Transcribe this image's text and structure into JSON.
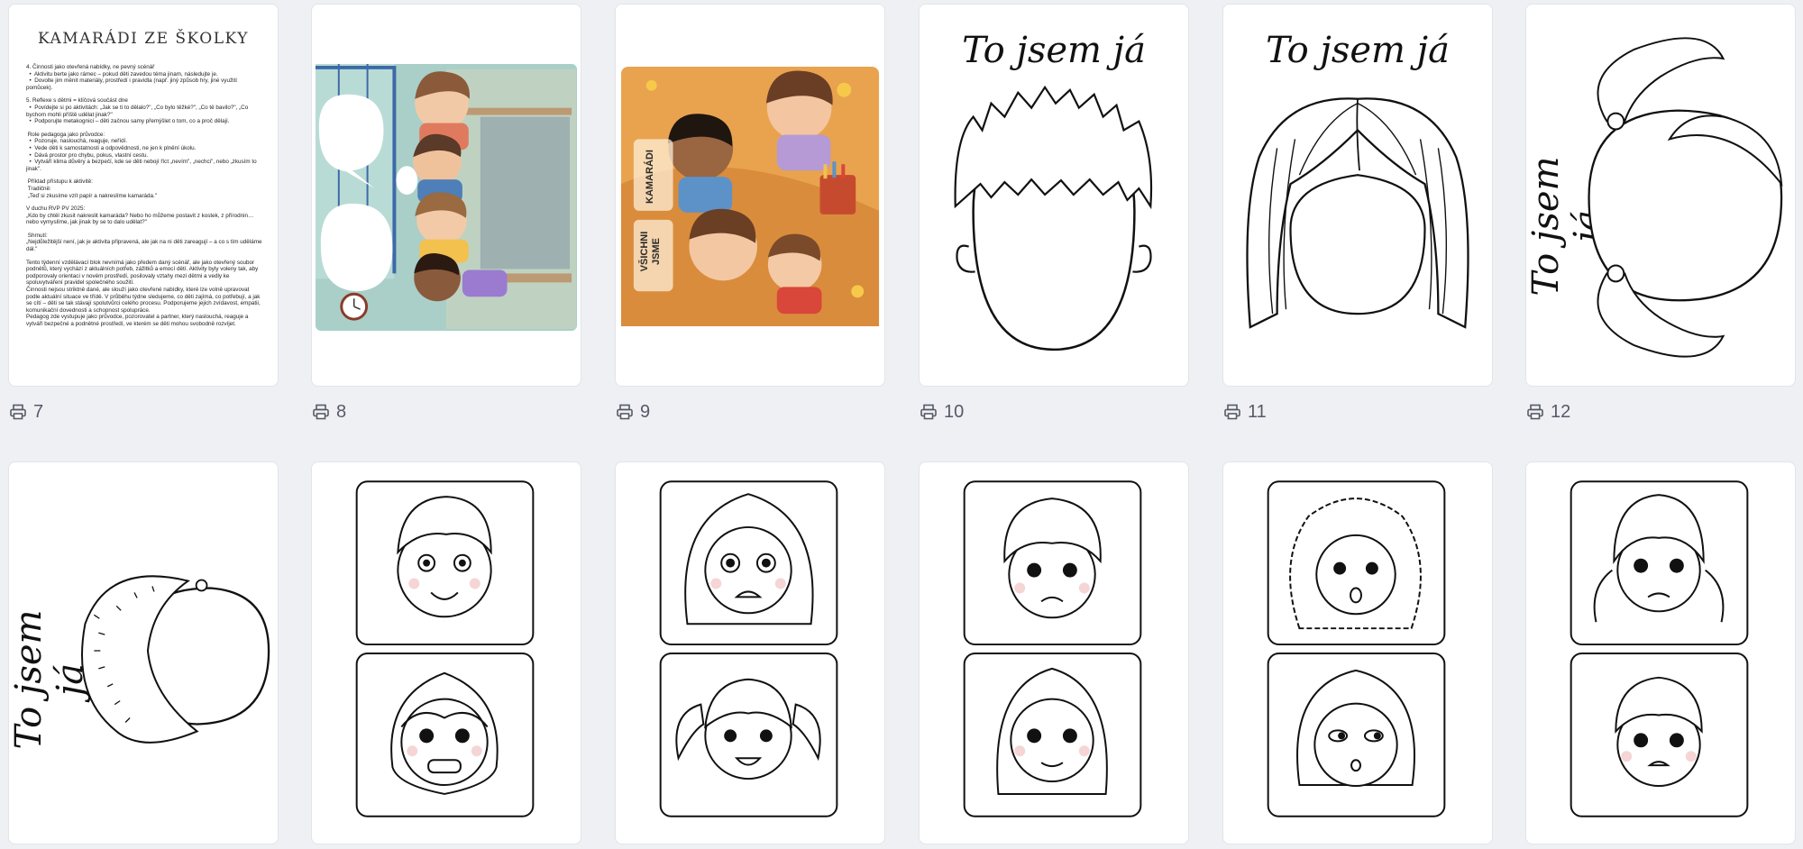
{
  "pages": [
    {
      "number": "7",
      "kind": "document"
    },
    {
      "number": "8",
      "kind": "illustration-classroom"
    },
    {
      "number": "9",
      "kind": "illustration-friends"
    },
    {
      "number": "10",
      "kind": "face-boy"
    },
    {
      "number": "11",
      "kind": "face-girl"
    },
    {
      "number": "12",
      "kind": "face-pigtails"
    }
  ],
  "document": {
    "title": "KAMARÁDI ZE ŠKOLKY",
    "lines": [
      "4. Činnosti jako otevřená nabídky, ne pevný scénář",
      "  •  Aktivitu berte jako rámec – pokud děti zavedou téma jinam, následujte je.",
      "  •  Dovolte jim měnit materiály, prostředí i pravidla (např. jiný způsob hry, jiné využití pomůcek).",
      "",
      "5. Reflexe s dětmi = klíčová součást dne",
      "  •  Povídejte si po aktivitách: „Jak se ti to dělalo?\", „Co bylo těžké?\", „Co tě bavilo?\", „Co bychom mohli příště udělat jinak?\"",
      "  •  Podporujte metakognici – děti začnou samy přemýšlet o tom, co a proč dělají.",
      "",
      " Role pedagoga jako průvodce:",
      "  •  Pozoruje, naslouchá, reaguje, neřídí.",
      "  •  Vede děti k samostatnosti a odpovědnosti, ne jen k plnění úkolu.",
      "  •  Dává prostor pro chybu, pokus, vlastní cestu.",
      "  •  Vytváří klima důvěry a bezpečí, kde se děti nebojí říct „nevím\", „nechci\", nebo „zkusím to jinak\".",
      "",
      " Příklad přístupu k aktivitě:",
      " Tradičně:",
      " „Teď si zkusíme vzít papír a nakreslíme kamaráda.\"",
      "",
      "V duchu RVP PV 2025:",
      "„Kdo by chtěl zkusit nakreslit kamaráda? Nebo ho můžeme postavit z kostek, z přírodnin… nebo vymyslíme, jak jinak by se to dalo udělat?\"",
      "",
      " Shrnutí:",
      "„Nejdůležitější není, jak je aktivita připravená, ale jak na ni děti zareagují – a co s tím uděláme dál.\"",
      "",
      "Tento týdenní vzdělávací blok nevnímá jako předem daný scénář, ale jako otevřený soubor podnětů, který vychází z aktuálních potřeb, zážitků a emocí dětí. Aktivity byly voleny tak, aby podporovaly orientaci v novém prostředí, posilovaly vztahy mezi dětmi a vedly ke spoluvytváření pravidel společného soužití.",
      "Činnosti nejsou striktně dané, ale slouží jako otevřené nabídky, které lze volně upravovat podle aktuální situace ve třídě. V průběhu týdne sledujeme, co děti zajímá, co potřebují, a jak se cítí – děti se tak stávají spolutvůrci celého procesu. Podporujeme jejich zvídavost, empatii, komunikační dovednosti a schopnost spolupráce.",
      "Pedagog zde vystupuje jako průvodce, pozorovatel a partner, který naslouchá, reaguje a vytváří bezpečné a podnětné prostředí, ve kterém se děti mohou svobodně rozvíjet."
    ]
  },
  "cover": {
    "line1": "KAMARÁDI",
    "line2": "VŠICHNI",
    "line3": "JSME"
  },
  "worksheet": {
    "title": "To jsem já"
  },
  "icons": {
    "page_number_icon": "printer-icon"
  },
  "colors": {
    "background": "#eef0f4",
    "card": "#ffffff",
    "number_text": "#555a66"
  }
}
